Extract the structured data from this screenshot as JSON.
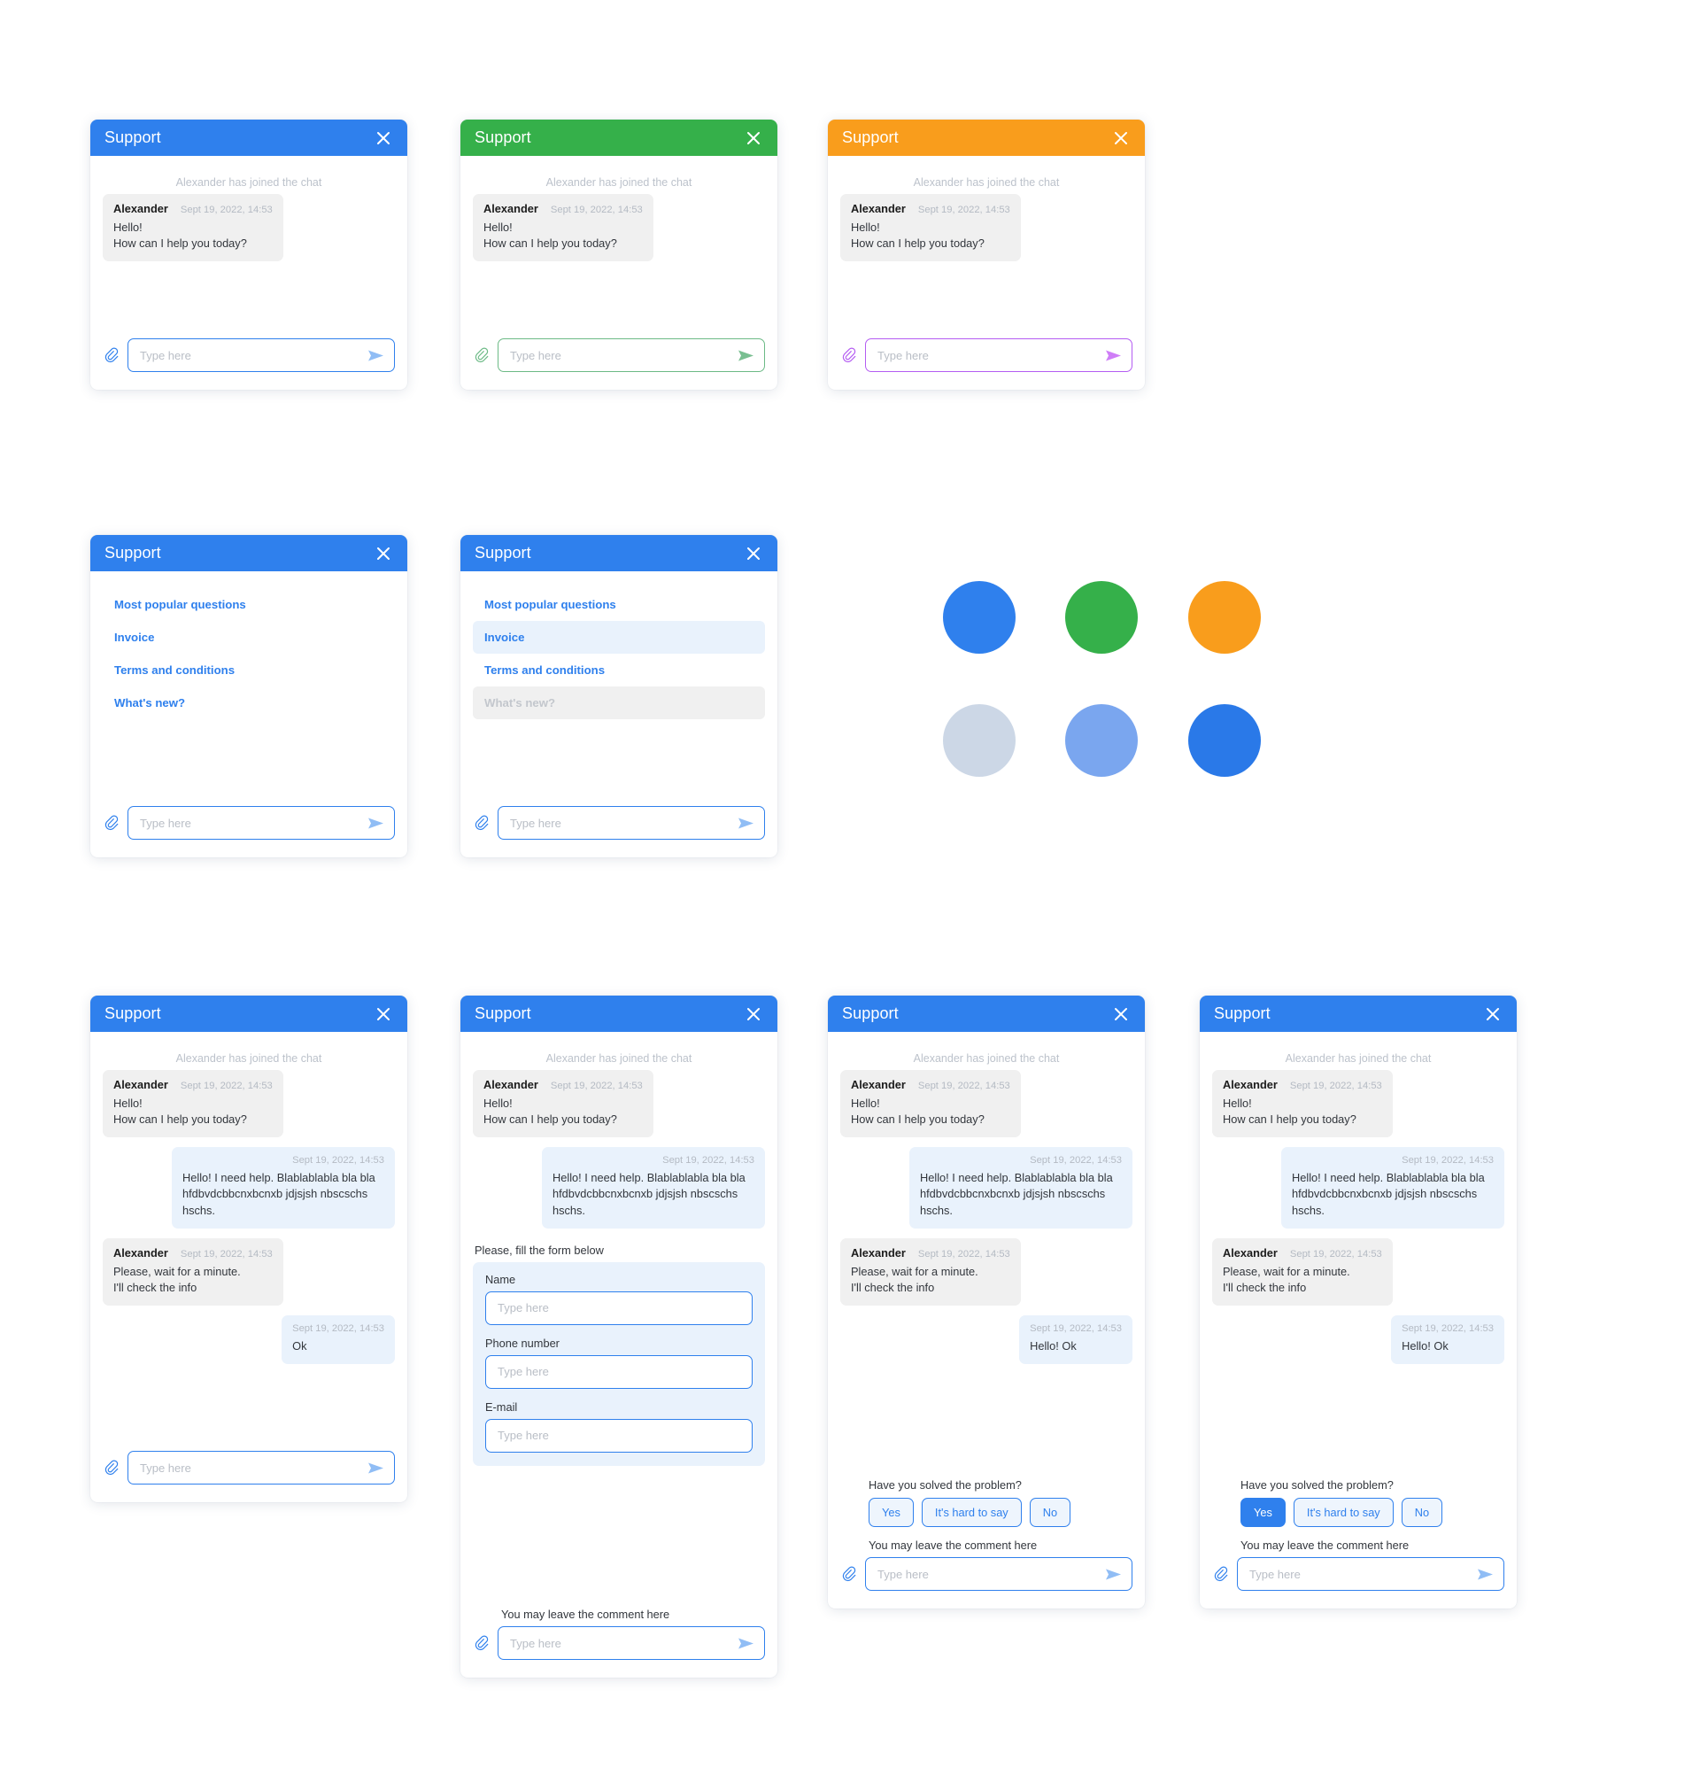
{
  "common": {
    "title": "Support",
    "close_label": "Close",
    "joined_notice": "Alexander has joined the chat",
    "placeholder": "Type here",
    "clip_icon": "paperclip-icon",
    "send_icon": "send-icon",
    "close_icon": "close-icon"
  },
  "messages": {
    "agent_name": "Alexander",
    "timestamp": "Sept 19, 2022, 14:53",
    "greeting": "Hello!\nHow can I help you today?",
    "user_long": "Hello! I need help. Blablablabla bla bla hfdbvdcbbcnxbcnxb jdjsjsh nbscschs hschs.",
    "agent_wait": "Please, wait for a minute.\nI'll check the info",
    "user_ok": "Ok",
    "user_hello_ok": "Hello! Ok"
  },
  "faq": {
    "items": [
      {
        "label": "Most popular questions",
        "state": "default"
      },
      {
        "label": "Invoice",
        "state": "default"
      },
      {
        "label": "Terms and conditions",
        "state": "default"
      },
      {
        "label": "What's new?",
        "state": "default"
      }
    ],
    "items_states": [
      {
        "label": "Most popular questions",
        "state": "default"
      },
      {
        "label": "Invoice",
        "state": "hover"
      },
      {
        "label": "Terms and conditions",
        "state": "default"
      },
      {
        "label": "What's new?",
        "state": "disabled"
      }
    ]
  },
  "form": {
    "intro": "Please, fill the form below",
    "fields": [
      {
        "label": "Name",
        "placeholder": "Type here"
      },
      {
        "label": "Phone number",
        "placeholder": "Type here"
      },
      {
        "label": "E-mail",
        "placeholder": "Type here"
      }
    ],
    "comment_label": "You may leave the comment here"
  },
  "survey": {
    "question": "Have you solved the problem?",
    "options": [
      "Yes",
      "It's hard to say",
      "No"
    ],
    "comment_label": "You may leave the comment here",
    "selected": "Yes"
  },
  "theme_swatches": [
    {
      "name": "blue",
      "hex": "#2f80ed"
    },
    {
      "name": "green",
      "hex": "#35b04a"
    },
    {
      "name": "orange",
      "hex": "#f99d1c"
    },
    {
      "name": "pale-blue",
      "hex": "#ccd7e6"
    },
    {
      "name": "medium-blue",
      "hex": "#7aa6ef"
    },
    {
      "name": "deep-blue",
      "hex": "#2a79e8"
    }
  ],
  "accents": {
    "blue_header": "#2f80ed",
    "green_header": "#35b04a",
    "orange_header": "#f99d1c",
    "green_input": "#6cba86",
    "purple_input": "#b45cf2"
  }
}
